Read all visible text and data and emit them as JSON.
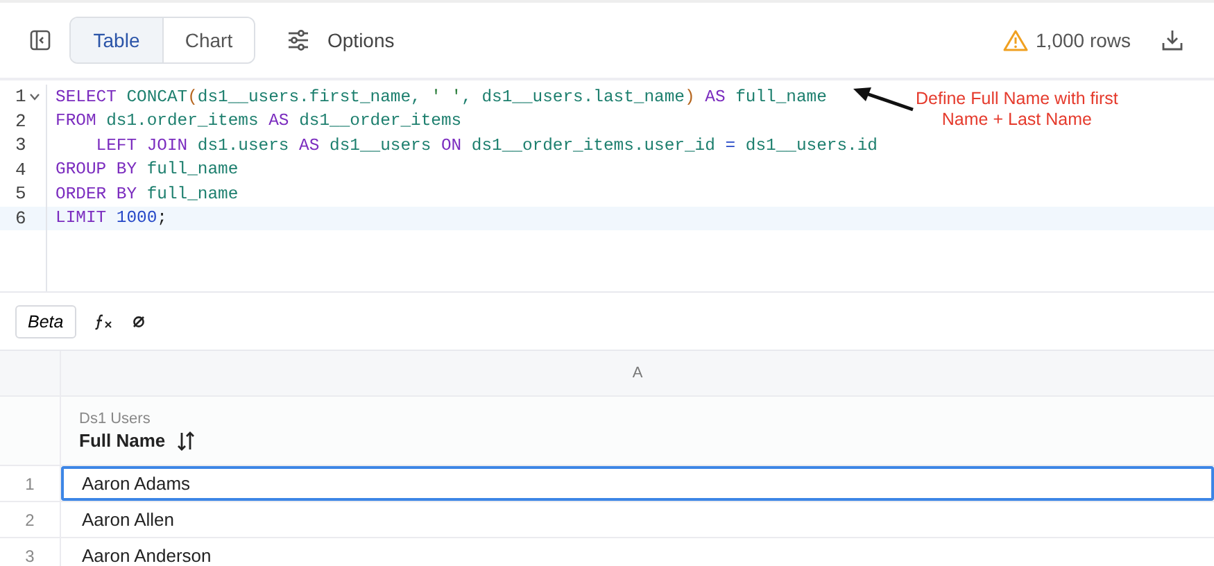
{
  "toolbar": {
    "view_tabs": [
      {
        "label": "Table",
        "selected": true
      },
      {
        "label": "Chart",
        "selected": false
      }
    ],
    "options_label": "Options",
    "row_count": "1,000 rows"
  },
  "editor": {
    "lines": [
      {
        "number": "1",
        "foldable": true,
        "active": false,
        "tokens": [
          {
            "kind": "keyword",
            "text": "SELECT "
          },
          {
            "kind": "function",
            "text": "CONCAT"
          },
          {
            "kind": "paren",
            "text": "("
          },
          {
            "kind": "ident",
            "text": "ds1__users.first_name, "
          },
          {
            "kind": "string",
            "text": "' '"
          },
          {
            "kind": "ident",
            "text": ", ds1__users.last_name"
          },
          {
            "kind": "paren",
            "text": ")"
          },
          {
            "kind": "keyword",
            "text": " AS "
          },
          {
            "kind": "ident",
            "text": "full_name"
          }
        ]
      },
      {
        "number": "2",
        "foldable": false,
        "active": false,
        "tokens": [
          {
            "kind": "keyword",
            "text": "FROM "
          },
          {
            "kind": "ident",
            "text": "ds1.order_items "
          },
          {
            "kind": "keyword",
            "text": "AS "
          },
          {
            "kind": "ident",
            "text": "ds1__order_items"
          }
        ]
      },
      {
        "number": "3",
        "foldable": false,
        "active": false,
        "tokens": [
          {
            "kind": "keyword",
            "text": "    LEFT JOIN "
          },
          {
            "kind": "ident",
            "text": "ds1.users "
          },
          {
            "kind": "keyword",
            "text": "AS "
          },
          {
            "kind": "ident",
            "text": "ds1__users "
          },
          {
            "kind": "keyword",
            "text": "ON "
          },
          {
            "kind": "ident",
            "text": "ds1__order_items.user_id "
          },
          {
            "kind": "operator",
            "text": "="
          },
          {
            "kind": "ident",
            "text": " ds1__users.id"
          }
        ]
      },
      {
        "number": "4",
        "foldable": false,
        "active": false,
        "tokens": [
          {
            "kind": "keyword",
            "text": "GROUP BY "
          },
          {
            "kind": "ident",
            "text": "full_name"
          }
        ]
      },
      {
        "number": "5",
        "foldable": false,
        "active": false,
        "tokens": [
          {
            "kind": "keyword",
            "text": "ORDER BY "
          },
          {
            "kind": "ident",
            "text": "full_name"
          }
        ]
      },
      {
        "number": "6",
        "foldable": false,
        "active": true,
        "tokens": [
          {
            "kind": "keyword",
            "text": "LIMIT "
          },
          {
            "kind": "number",
            "text": "1000"
          },
          {
            "kind": "plain",
            "text": ";"
          }
        ]
      }
    ]
  },
  "annotation": {
    "lines": [
      "Define Full Name with first",
      "Name + Last Name"
    ]
  },
  "formula_bar": {
    "beta_label": "Beta"
  },
  "grid": {
    "column_letter": "A",
    "column_group": "Ds1 Users",
    "column_title": "Full Name",
    "rows": [
      {
        "number": "1",
        "value": "Aaron Adams",
        "selected": true
      },
      {
        "number": "2",
        "value": "Aaron Allen",
        "selected": false
      },
      {
        "number": "3",
        "value": "Aaron Anderson",
        "selected": false
      }
    ]
  }
}
